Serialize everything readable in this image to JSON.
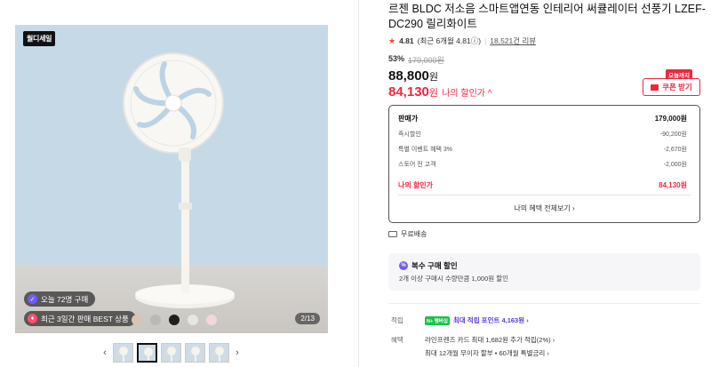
{
  "gallery": {
    "badge": "월디세일",
    "pill_today": "오늘 72명 구매",
    "pill_best": "최근 3일간 판매 BEST 상품",
    "counter": "2/13",
    "color_dots": [
      "#e9e5dd",
      "#d8c4b2",
      "#b9b9b9",
      "#1f1f1f",
      "#e6e6e6",
      "#f2d7dc"
    ],
    "prev_arrow": "‹",
    "next_arrow": "›"
  },
  "product": {
    "title": "르젠 BLDC 저소음 스마트앱연동 인테리어 써큘레이터 선풍기 LZEF-DC290 릴리화이트",
    "rating": {
      "score": "4.81",
      "recent": "(최근 6개월 4.81ⓘ)",
      "reviews": "18,521건 리뷰"
    },
    "discount_rate": "53%",
    "original_price": "179,000원",
    "price": "88,800",
    "price_unit": "원",
    "my_price": "84,130",
    "my_price_unit": "원",
    "my_price_label": "나의 할인가 ^",
    "coupon_tag": "오늘까지",
    "coupon_button": "쿠폰 받기"
  },
  "breakdown": {
    "head_label": "판매가",
    "head_value": "179,000원",
    "rows": [
      {
        "label": "즉시할인",
        "value": "-90,200원"
      },
      {
        "label": "특별 이벤트 혜택 3%",
        "value": "-2,670원"
      },
      {
        "label": "스토어 전 고객",
        "value": "-2,000원"
      }
    ],
    "mine_label": "나의 할인가",
    "mine_value": "84,130원",
    "all_benefits": "나의 혜택 전체보기 ›"
  },
  "shipping": {
    "text": "무료배송"
  },
  "multi": {
    "title": "복수 구매 할인",
    "desc": "2개 이상 구매시 수량만큼 1,000원 할인"
  },
  "benefits": {
    "point_label": "적립",
    "npay": "N+ 멤버십",
    "point_text": "최대 적립 포인트 4,163원 ›",
    "benefit_label": "혜택",
    "benefit_line1": "라인프렌즈 카드 최대 1,682원 추가 적립(2%) ›",
    "benefit_line2": "최대 12개월 무이자 할부 • 60개월 특별금리 ›"
  }
}
